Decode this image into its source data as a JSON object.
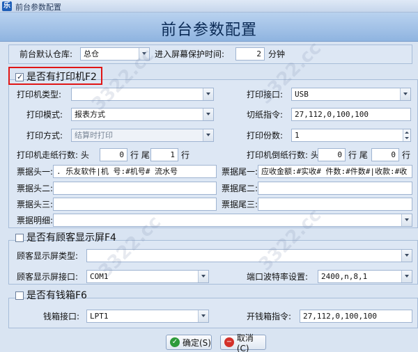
{
  "window": {
    "title": "前台参数配置",
    "app_icon": "乐"
  },
  "header": {
    "title": "前台参数配置"
  },
  "top": {
    "warehouse_label": "前台默认仓库:",
    "warehouse_value": "总仓",
    "screensaver_label": "进入屏幕保护时间:",
    "screensaver_value": "2",
    "screensaver_unit": "分钟"
  },
  "printer": {
    "section_label": "是否有打印机F2",
    "checked": true,
    "type_label": "打印机类型:",
    "type_value": "",
    "port_label": "打印接口:",
    "port_value": "USB",
    "mode_label": "打印模式:",
    "mode_value": "报表方式",
    "cut_label": "切纸指令:",
    "cut_value": "27,112,0,100,100",
    "method_label": "打印方式:",
    "method_value": "结算时打印",
    "copies_label": "打印份数:",
    "copies_value": "1",
    "feed_label": "打印机走纸行数: 头",
    "feed_head": "0",
    "feed_tail_label": "行 尾",
    "feed_tail": "1",
    "feed_unit": "行",
    "reverse_label": "打印机倒纸行数: 头",
    "reverse_head": "0",
    "reverse_tail_label": "行 尾",
    "reverse_tail": "0",
    "reverse_unit": "行",
    "header1_label": "票据头一:",
    "header1_value": ".            乐友软件|机 号:#机号#   流水号",
    "footer1_label": "票据尾一:",
    "footer1_value": "应收金额:#实收#  件数:#件数#|收款:#收",
    "header2_label": "票据头二:",
    "header2_value": "",
    "footer2_label": "票据尾二:",
    "footer2_value": "",
    "header3_label": "票据头三:",
    "header3_value": "",
    "footer3_label": "票据尾三:",
    "footer3_value": "",
    "detail_label": "票据明细:",
    "detail_value": ""
  },
  "customer_display": {
    "section_label": "是否有顾客显示屏F4",
    "checked": false,
    "type_label": "顾客显示屏类型:",
    "type_value": "",
    "port_label": "顾客显示屏接口:",
    "port_value": "COM1",
    "baud_label": "端口波特率设置:",
    "baud_value": "2400,n,8,1"
  },
  "cashbox": {
    "section_label": "是否有钱箱F6",
    "checked": false,
    "port_label": "钱箱接口:",
    "port_value": "LPT1",
    "cmd_label": "开钱箱指令:",
    "cmd_value": "27,112,0,100,100"
  },
  "buttons": {
    "ok": "确定(S)",
    "cancel": "取消(C)"
  },
  "watermark": "3322.cc"
}
